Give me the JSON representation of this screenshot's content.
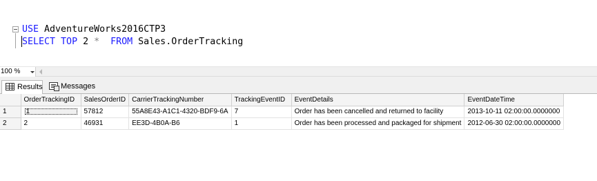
{
  "editor": {
    "line1": {
      "keyword": "USE",
      "ident": " AdventureWorks2016CTP3"
    },
    "line2": {
      "kw1": "SELECT",
      "kw2": " TOP",
      "num": " 2",
      "star": " *",
      "kw3": "  FROM",
      "ident": " Sales.OrderTracking"
    }
  },
  "zoom": {
    "value": "100 %"
  },
  "tabs": [
    {
      "label": "Results",
      "icon": "grid-icon"
    },
    {
      "label": "Messages",
      "icon": "messages-icon"
    }
  ],
  "grid": {
    "columns": [
      "OrderTrackingID",
      "SalesOrderID",
      "CarrierTrackingNumber",
      "TrackingEventID",
      "EventDetails",
      "EventDateTime"
    ],
    "rows": [
      {
        "num": "1",
        "cells": [
          "1",
          "57812",
          "55A8E43-A1C1-4320-BDF9-6A",
          "7",
          "Order has been cancelled and returned to facility",
          "2013-10-11 02:00:00.0000000"
        ]
      },
      {
        "num": "2",
        "cells": [
          "2",
          "46931",
          "EE3D-4B0A-B6",
          "1",
          "Order has been processed and packaged for shipment",
          "2012-06-30 02:00:00.0000000"
        ]
      }
    ]
  }
}
